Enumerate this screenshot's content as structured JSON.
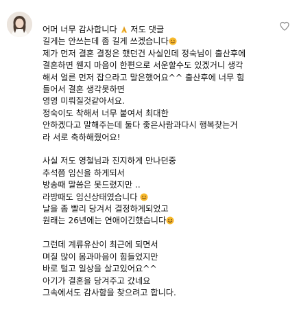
{
  "comment": {
    "avatar_icon": "profile-photo",
    "like_icon": "heart-outline-icon",
    "lines": [
      {
        "parts": [
          "어머 너무 감사합니다 ",
          {
            "emoji": "folded-hands"
          },
          " 저도 댓글"
        ]
      },
      {
        "parts": [
          "길게는 안쓰는데 좀 길게 쓰겠습니다",
          {
            "emoji": "smiling-face"
          }
        ]
      },
      {
        "parts": [
          "제가 먼저 결혼 결정은 했던건 사실인데 정숙님이 출산후에"
        ]
      },
      {
        "parts": [
          "결혼하면 웬지 마음이 한편으로 서운할수도 있겠거니 생각"
        ]
      },
      {
        "parts": [
          "해서 얼른 먼저 잡으라고 말은했어요^^ 출산후에 너무 힘"
        ]
      },
      {
        "parts": [
          "들어서 결혼 생각못하면"
        ]
      },
      {
        "parts": [
          "영영 미뤄질것같아서요."
        ]
      },
      {
        "parts": [
          "정숙이도 착해서 너무 붙여서 최대한"
        ]
      },
      {
        "parts": [
          "안하겠다고 말해주는데 둘다 좋은사람과다시 행복찾는거"
        ]
      },
      {
        "parts": [
          "라 서로 축하해줬어요!"
        ]
      },
      {
        "gap": true
      },
      {
        "parts": [
          "사실 저도 영철님과 진지하게 만나던중"
        ]
      },
      {
        "parts": [
          "추석쯤 임신을 하게되서"
        ]
      },
      {
        "parts": [
          "방송때 말씀은 못드렸지만 .."
        ]
      },
      {
        "parts": [
          "라방때도 임신상태였습니다 ",
          {
            "emoji": "smiling-face"
          }
        ]
      },
      {
        "parts": [
          "날을 좀 빨리 당겨서 결정하게되었고"
        ]
      },
      {
        "parts": [
          "원래는 26년에는 연애이긴했습니다",
          {
            "emoji": "smiling-face"
          }
        ]
      },
      {
        "gap": true
      },
      {
        "parts": [
          "그런데 계류유산이 최근에 되면서"
        ]
      },
      {
        "parts": [
          "며칠 많이 몸과마음이 힘들었지만"
        ]
      },
      {
        "parts": [
          "바로 털고 일상을 살고있어요^^"
        ]
      },
      {
        "parts": [
          "아기가 결혼을 당겨주고 갔네요"
        ]
      },
      {
        "parts": [
          "그속에서도 감사함을 찾으려고 합니다."
        ]
      }
    ]
  },
  "colors": {
    "text": "#111111",
    "like_icon": "#8e8e8e",
    "emoji_face": "#f7b92b",
    "emoji_hands": "#f2b52a"
  }
}
